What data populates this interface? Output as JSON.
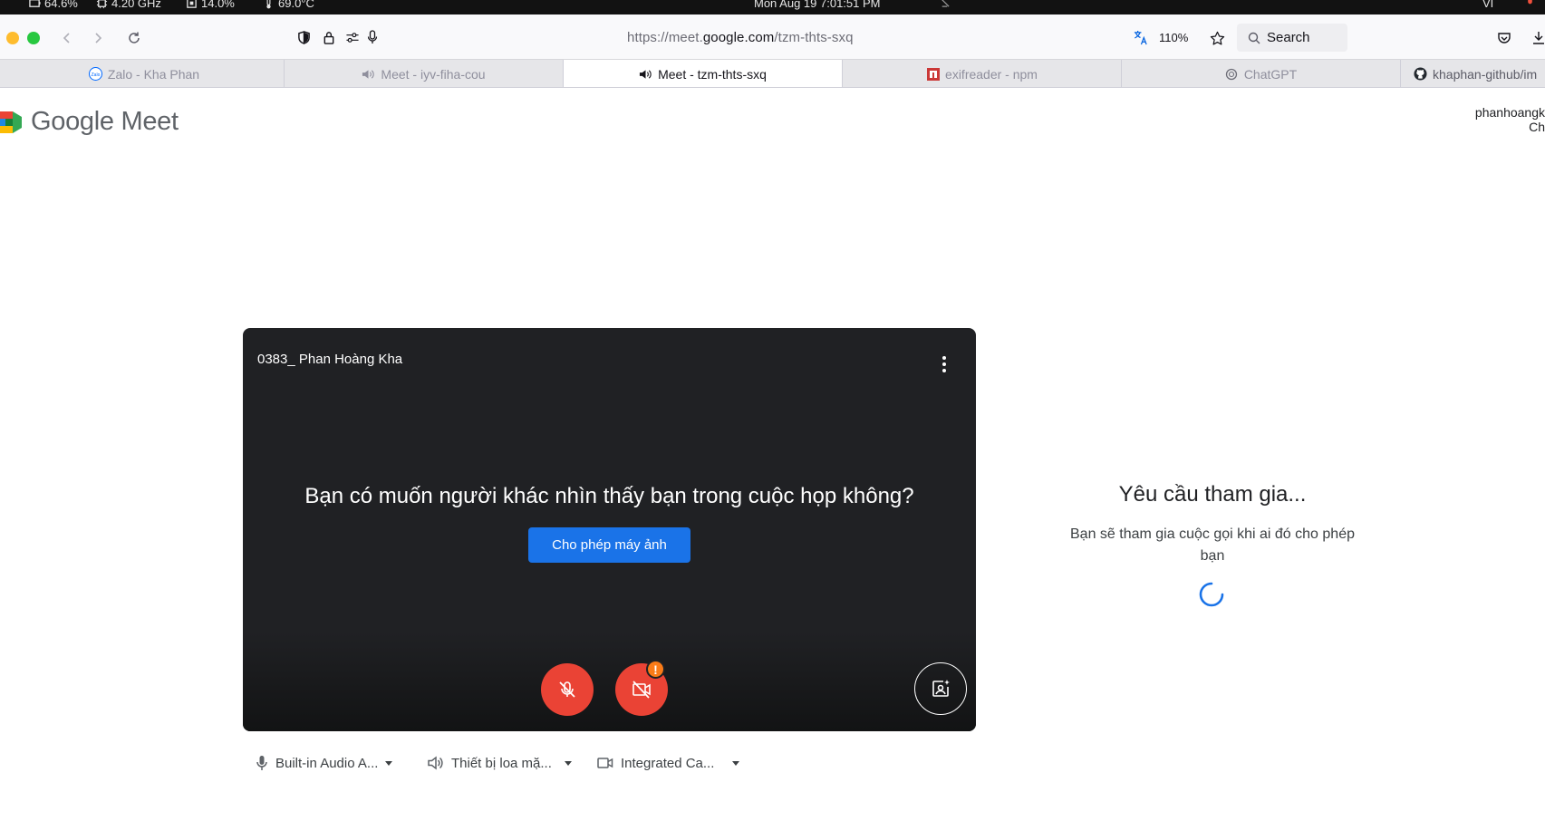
{
  "menubar": {
    "battery": "64.6%",
    "cpu_freq": "4.20 GHz",
    "memory": "14.0%",
    "temp": "69.0°C",
    "datetime": "Mon Aug 19   7:01:51 PM",
    "input_lang": "VI"
  },
  "toolbar": {
    "url_prefix": "https://meet.",
    "url_domain": "google.com",
    "url_path": "/tzm-thts-sxq",
    "zoom": "110%",
    "search_label": "Search"
  },
  "tabs": [
    {
      "label": "Zalo - Kha Phan",
      "icon": "zalo-icon"
    },
    {
      "label": "Meet - iyv-fiha-cou",
      "icon": "speaker-icon"
    },
    {
      "label": "Meet - tzm-thts-sxq",
      "icon": "speaker-icon",
      "active": true
    },
    {
      "label": "exifreader - npm",
      "icon": "npm-icon"
    },
    {
      "label": "ChatGPT",
      "icon": "chatgpt-icon"
    },
    {
      "label": "khaphan-github/im",
      "icon": "github-icon"
    }
  ],
  "page": {
    "logo_text": "Google Meet",
    "account_line1": "phanhoangk",
    "account_line2": "Ch"
  },
  "video": {
    "participant_name": "0383_ Phan Hoàng Kha",
    "question": "Bạn có muốn người khác nhìn thấy bạn trong cuộc họp không?",
    "allow_camera_label": "Cho phép máy ảnh",
    "warning_mark": "!"
  },
  "devices": {
    "microphone": "Built-in Audio A...",
    "speaker": "Thiết bị loa mặ...",
    "camera": "Integrated Ca..."
  },
  "join": {
    "title": "Yêu cầu tham gia...",
    "subtitle": "Bạn sẽ tham gia cuộc gọi khi ai đó cho phép bạn"
  },
  "colors": {
    "accent_blue": "#1a73e8",
    "danger_red": "#ea4335",
    "warning_orange": "#fa7b17",
    "video_bg": "#202124"
  }
}
